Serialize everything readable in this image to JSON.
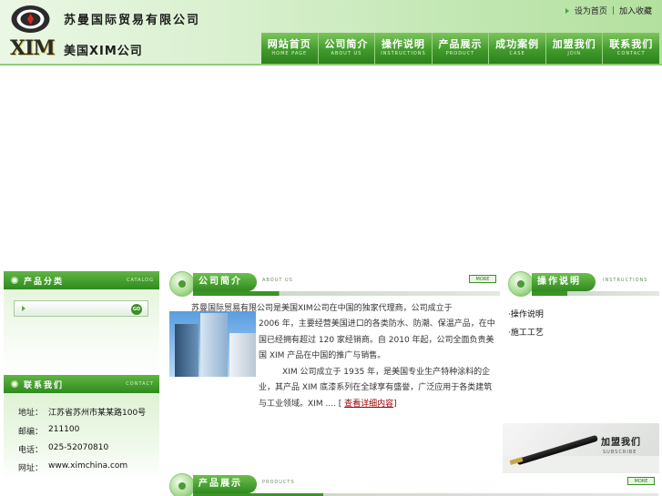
{
  "header": {
    "company_name": "苏曼国际贸易有限公司",
    "company_sub": "美国XIM公司",
    "logo_text": "XIM",
    "toplinks": {
      "set_home": "设为首页",
      "separator": "|",
      "bookmark": "加入收藏"
    }
  },
  "nav": [
    {
      "cn": "网站首页",
      "en": "HOME PAGE"
    },
    {
      "cn": "公司简介",
      "en": "ABOUT US"
    },
    {
      "cn": "操作说明",
      "en": "INSTRUCTIONS"
    },
    {
      "cn": "产品展示",
      "en": "PRODUCT"
    },
    {
      "cn": "成功案例",
      "en": "CASE"
    },
    {
      "cn": "加盟我们",
      "en": "JOIN"
    },
    {
      "cn": "联系我们",
      "en": "CONTACT"
    }
  ],
  "catalog": {
    "title": "产品分类",
    "title_en": "CATALOG",
    "go_label": "GO"
  },
  "contact": {
    "title": "联系我们",
    "title_en": "CONTACT",
    "rows": [
      {
        "key": "地址：",
        "value": "江苏省苏州市某某路100号"
      },
      {
        "key": "邮编：",
        "value": "211100"
      },
      {
        "key": "电话：",
        "value": "025-52070810"
      },
      {
        "key": "网址：",
        "value": "www.ximchina.com"
      }
    ]
  },
  "about": {
    "title": "公司简介",
    "title_en": "ABOUT US",
    "more": "MORE",
    "lead": "苏曼国际贸易有限公司是美国XIM公司在中国的独家代理商，公司成立于",
    "p1": "2006 年，主要经营美国进口的各类防水、防潮、保温产品，在中国已经拥有超过 120 家经销商。自 2010 年起，公司全面负责美国 XIM 产品在中国的推广与销售。",
    "p2": "XIM 公司成立于 1935 年，是美国专业生产特种涂料的企业，其产品 XIM 底漆系列在全球享有盛誉，广泛应用于各类建筑与工业领域。XIM ....",
    "more_link": "查看详细内容"
  },
  "instructions": {
    "title": "操作说明",
    "title_en": "INSTRUCTIONS",
    "items": [
      "·操作说明",
      "·施工工艺"
    ]
  },
  "join_banner": {
    "cn": "加盟我们",
    "en": "SUBSCRIBE"
  },
  "products": {
    "title": "产品展示",
    "title_en": "PRODUCTS",
    "more": "MORE"
  }
}
